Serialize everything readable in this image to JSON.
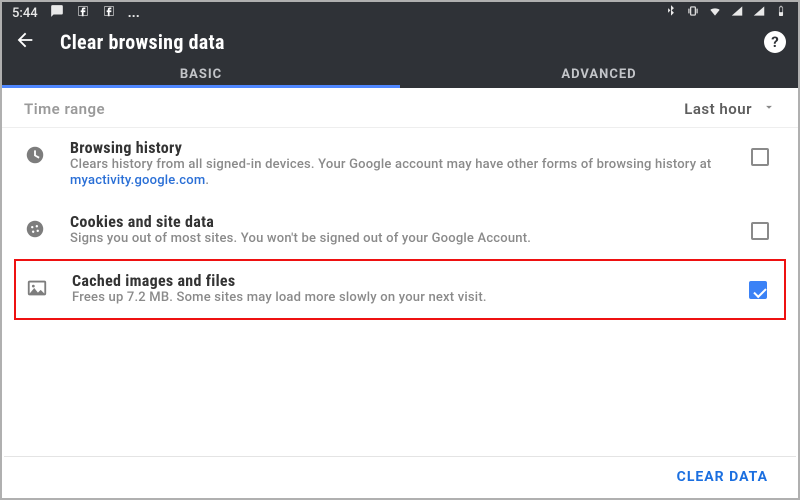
{
  "status": {
    "time": "5:44"
  },
  "header": {
    "title": "Clear browsing data"
  },
  "tabs": {
    "basic": "BASIC",
    "advanced": "ADVANCED"
  },
  "timerange": {
    "label": "Time range",
    "value": "Last hour"
  },
  "items": [
    {
      "title": "Browsing history",
      "desc_pre": "Clears history from all signed-in devices. Your Google account may have other forms of browsing history at ",
      "link": "myactivity.google.com",
      "desc_post": ".",
      "checked": false
    },
    {
      "title": "Cookies and site data",
      "desc": "Signs you out of most sites. You won't be signed out of your Google Account.",
      "checked": false
    },
    {
      "title": "Cached images and files",
      "desc": "Frees up 7.2 MB. Some sites may load more slowly on your next visit.",
      "checked": true
    }
  ],
  "footer": {
    "clear": "CLEAR DATA"
  }
}
